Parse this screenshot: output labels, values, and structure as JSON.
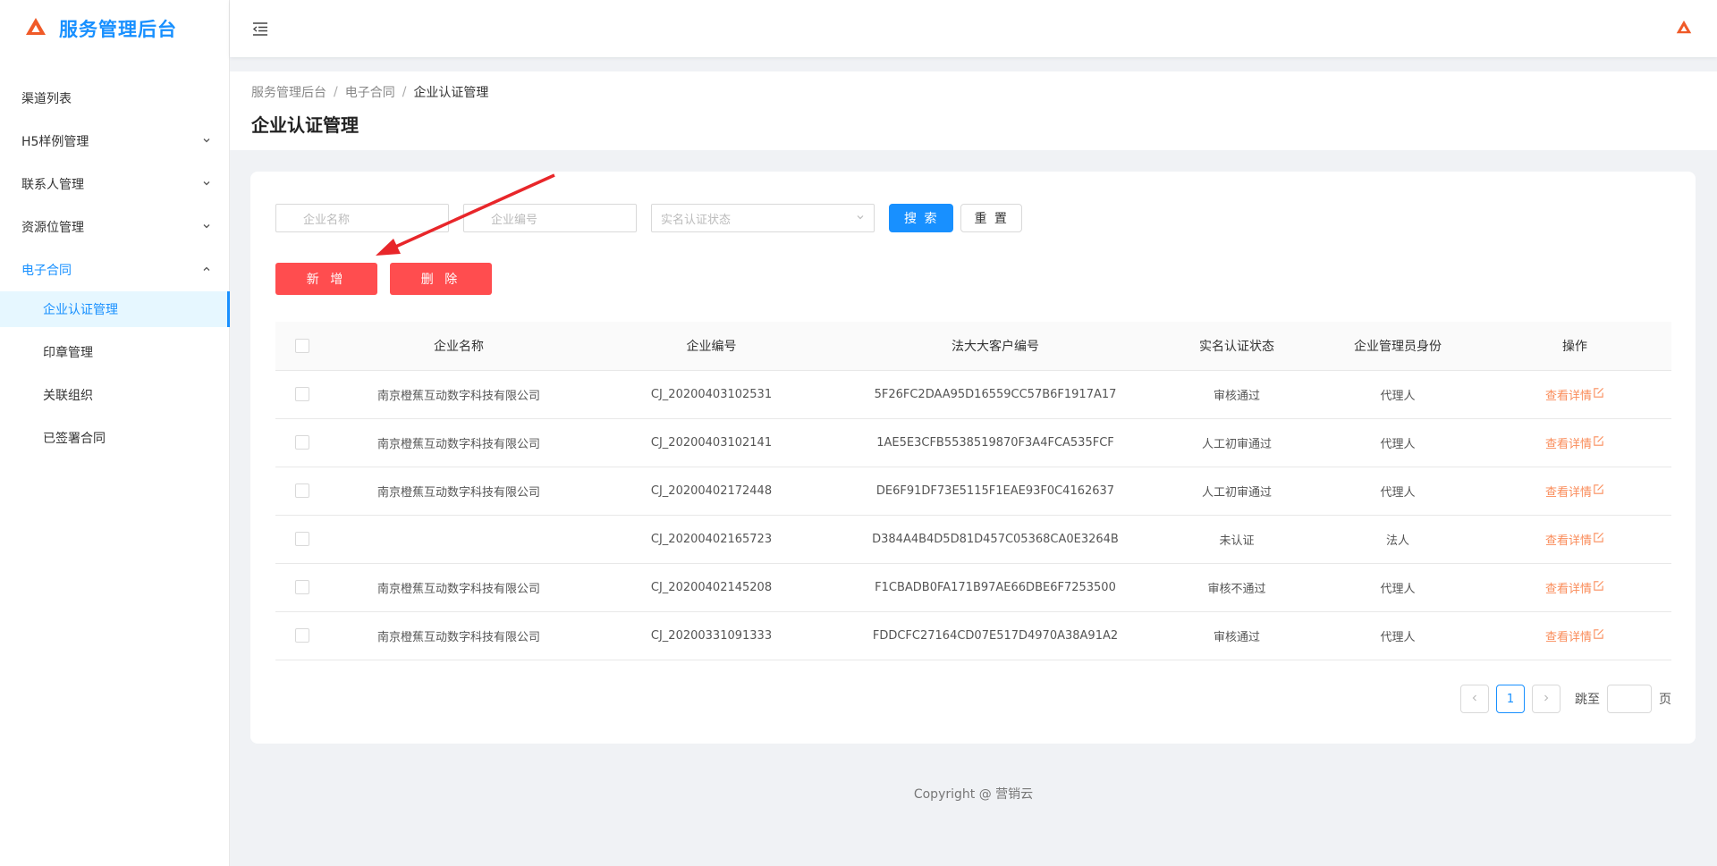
{
  "app": {
    "title": "服务管理后台"
  },
  "sidebar": {
    "items": [
      {
        "label": "渠道列表",
        "has_children": false
      },
      {
        "label": "H5样例管理",
        "has_children": true
      },
      {
        "label": "联系人管理",
        "has_children": true
      },
      {
        "label": "资源位管理",
        "has_children": true
      },
      {
        "label": "电子合同",
        "has_children": true,
        "open": true,
        "children": [
          {
            "label": "企业认证管理",
            "active": true
          },
          {
            "label": "印章管理"
          },
          {
            "label": "关联组织"
          },
          {
            "label": "已签署合同"
          }
        ]
      }
    ]
  },
  "breadcrumb": [
    "服务管理后台",
    "电子合同",
    "企业认证管理"
  ],
  "page_title": "企业认证管理",
  "filters": {
    "company_name_placeholder": "企业名称",
    "company_code_placeholder": "企业编号",
    "auth_status_placeholder": "实名认证状态",
    "search_label": "搜 索",
    "reset_label": "重 置"
  },
  "actions": {
    "add_label": "新 增",
    "delete_label": "删 除"
  },
  "table": {
    "columns": [
      "企业名称",
      "企业编号",
      "法大大客户编号",
      "实名认证状态",
      "企业管理员身份",
      "操作"
    ],
    "rows": [
      {
        "name": "南京橙蕉互动数字科技有限公司",
        "code": "CJ_20200403102531",
        "fdd_id": "5F26FC2DAA95D16559CC57B6F1917A17",
        "status": "审核通过",
        "role": "代理人",
        "action": "查看详情"
      },
      {
        "name": "南京橙蕉互动数字科技有限公司",
        "code": "CJ_20200403102141",
        "fdd_id": "1AE5E3CFB5538519870F3A4FCA535FCF",
        "status": "人工初审通过",
        "role": "代理人",
        "action": "查看详情"
      },
      {
        "name": "南京橙蕉互动数字科技有限公司",
        "code": "CJ_20200402172448",
        "fdd_id": "DE6F91DF73E5115F1EAE93F0C4162637",
        "status": "人工初审通过",
        "role": "代理人",
        "action": "查看详情"
      },
      {
        "name": "",
        "code": "CJ_20200402165723",
        "fdd_id": "D384A4B4D5D81D457C05368CA0E3264B",
        "status": "未认证",
        "role": "法人",
        "action": "查看详情"
      },
      {
        "name": "南京橙蕉互动数字科技有限公司",
        "code": "CJ_20200402145208",
        "fdd_id": "F1CBADB0FA171B97AE66DBE6F7253500",
        "status": "审核不通过",
        "role": "代理人",
        "action": "查看详情"
      },
      {
        "name": "南京橙蕉互动数字科技有限公司",
        "code": "CJ_20200331091333",
        "fdd_id": "FDDCFC27164CD07E517D4970A38A91A2",
        "status": "审核通过",
        "role": "代理人",
        "action": "查看详情"
      }
    ]
  },
  "pagination": {
    "current_page": "1",
    "jump_label": "跳至",
    "page_suffix": "页"
  },
  "footer": {
    "text": "Copyright @ 营销云"
  },
  "colors": {
    "primary": "#1890ff",
    "danger": "#ff4d4f",
    "link": "#fa8c5a",
    "logo": "#f05a28",
    "arrow": "#e8262a"
  },
  "icons": {
    "logo": "triangle-logo-icon",
    "fold": "menu-fold-icon",
    "chevron": "chevron-icon",
    "edit": "edit-link-icon"
  }
}
